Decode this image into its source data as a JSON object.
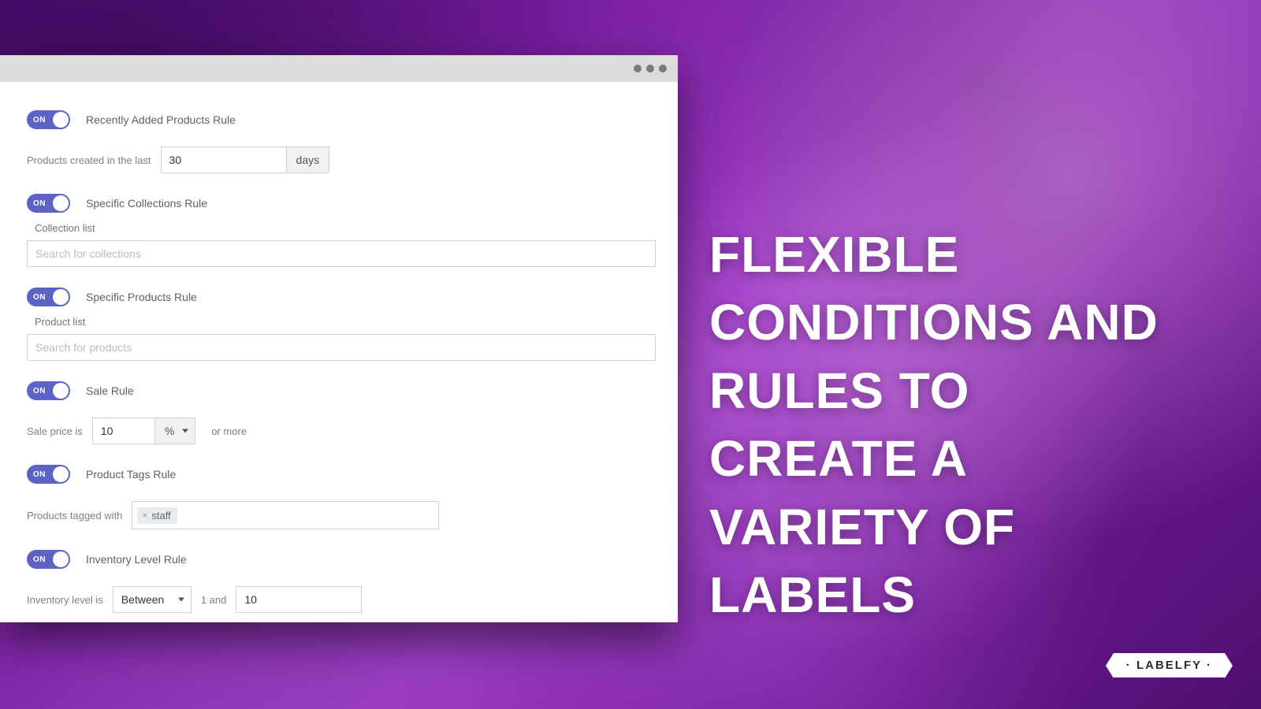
{
  "toggle_label": "ON",
  "recent": {
    "title": "Recently Added Products Rule",
    "lead": "Products created in the last",
    "value": "30",
    "suffix": "days"
  },
  "collections": {
    "title": "Specific Collections Rule",
    "list_label": "Collection list",
    "placeholder": "Search for collections"
  },
  "products": {
    "title": "Specific Products Rule",
    "list_label": "Product list",
    "placeholder": "Search for products"
  },
  "sale": {
    "title": "Sale Rule",
    "lead": "Sale price is",
    "value": "10",
    "unit": "%",
    "trail": "or more"
  },
  "tags": {
    "title": "Product Tags Rule",
    "lead": "Products tagged with",
    "chip": "staff"
  },
  "inventory": {
    "title": "Inventory Level Rule",
    "lead": "Inventory level is",
    "mode": "Between",
    "mid": "1 and",
    "value": "10"
  },
  "marketing_text": "Flexible conditions and rules to create a variety of labels",
  "brand": "· LABELFY ·"
}
